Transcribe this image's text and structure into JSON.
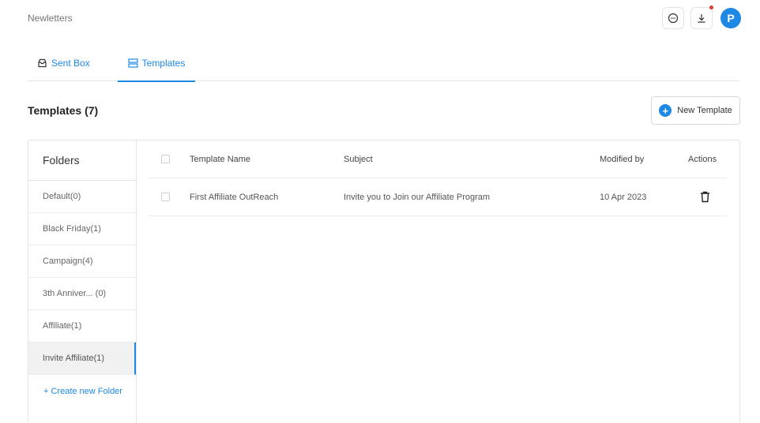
{
  "page": {
    "title": "Newletters"
  },
  "header_icons": [
    {
      "name": "chat-icon"
    },
    {
      "name": "download-icon"
    }
  ],
  "user": {
    "avatar_letter": "P"
  },
  "tabs": [
    {
      "label": "Sent Box",
      "icon": "inbox-icon"
    },
    {
      "label": "Templates",
      "icon": "template-icon",
      "active": true
    }
  ],
  "section": {
    "title": "Templates (7)"
  },
  "new_template_button": {
    "label": "New Template"
  },
  "folders": {
    "header": "Folders",
    "items": [
      {
        "label": "Default(0)"
      },
      {
        "label": "Black Friday(1)"
      },
      {
        "label": "Campaign(4)"
      },
      {
        "label": "3th Anniver... (0)"
      },
      {
        "label": "Affiliate(1)"
      },
      {
        "label": "Invite Affiliate(1)",
        "active": true
      }
    ],
    "create_label": "+ Create new Folder"
  },
  "table": {
    "columns": [
      "Template Name",
      "Subject",
      "Modified by",
      "Actions"
    ],
    "rows": [
      {
        "name": "First Affiliate OutReach",
        "subject": "Invite you to Join our Affiliate Program",
        "modified": "10 Apr 2023"
      }
    ]
  },
  "colors": {
    "accent": "#1e88e5",
    "notification": "#e53935"
  }
}
